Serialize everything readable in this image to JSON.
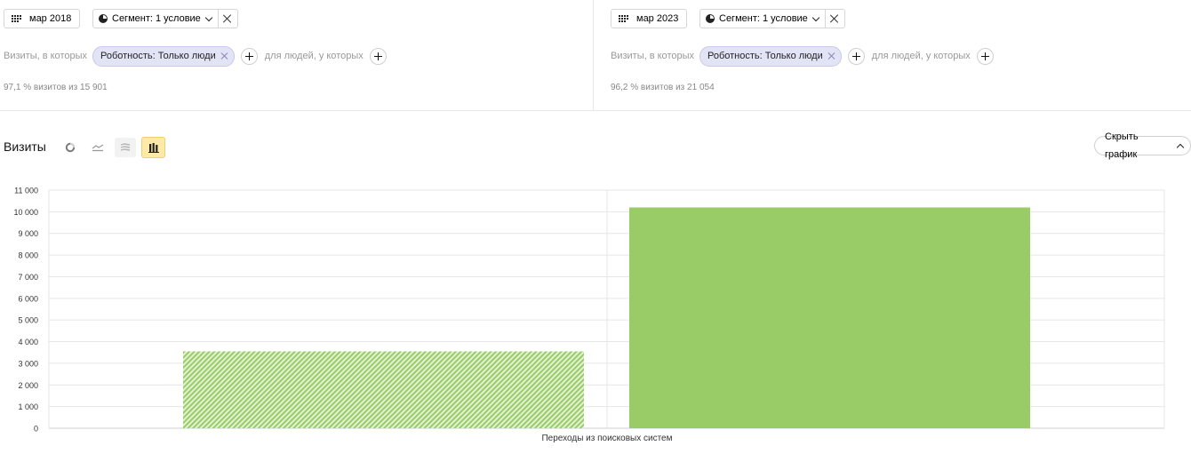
{
  "left_panel": {
    "period_label": "мар 2018",
    "segment_label": "Сегмент: 1 условие",
    "visits_prefix": "Визиты, в которых",
    "chip_label": "Роботность: Только люди",
    "people_label": "для людей, у которых",
    "share_text": "97,1 % визитов из 15 901"
  },
  "right_panel": {
    "period_label": "мар 2023",
    "segment_label": "Сегмент: 1 условие",
    "visits_prefix": "Визиты, в которых",
    "chip_label": "Роботность: Только люди",
    "people_label": "для людей, у которых",
    "share_text": "96,2 % визитов из 21 054"
  },
  "chart_header": {
    "title": "Визиты",
    "hide_button_label": "Скрыть график",
    "view_icons": [
      "pie-chart-icon",
      "line-chart-icon",
      "stacked-area-icon",
      "bar-chart-icon"
    ],
    "active_view": "bar-chart-icon"
  },
  "colors": {
    "bar": "#99cc66",
    "hatch_light": "#d4ecb9",
    "grid": "#e6e6e6",
    "active_icon_bg": "#ffe9a8"
  },
  "chart_data": {
    "type": "bar",
    "categories": [
      "Переходы из поисковых систем"
    ],
    "series": [
      {
        "period": "мар 2018",
        "values": [
          3550
        ],
        "style": "hatched"
      },
      {
        "period": "мар 2023",
        "values": [
          10200
        ],
        "style": "solid"
      }
    ],
    "ylim": [
      0,
      11000
    ],
    "yticks": [
      "0",
      "1 000",
      "2 000",
      "3 000",
      "4 000",
      "5 000",
      "6 000",
      "7 000",
      "8 000",
      "9 000",
      "10 000",
      "11 000"
    ],
    "grid": true
  }
}
